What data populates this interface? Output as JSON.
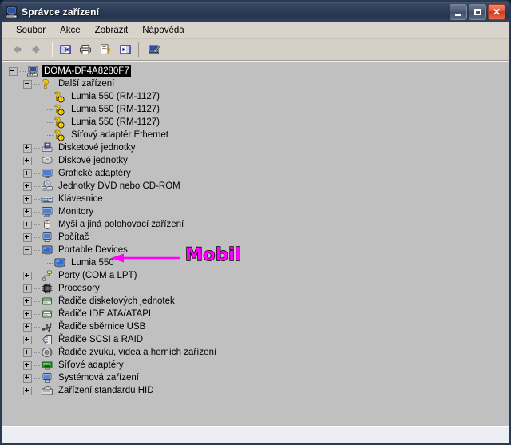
{
  "window": {
    "title": "Správce zařízení",
    "title_icon": "computer-icon",
    "buttons": {
      "minimize": "Minimalizovat",
      "maximize": "Maximalizovat",
      "close": "Zavřít"
    }
  },
  "menu": {
    "items": [
      {
        "label": "Soubor",
        "name": "menu-soubor"
      },
      {
        "label": "Akce",
        "name": "menu-akce"
      },
      {
        "label": "Zobrazit",
        "name": "menu-zobrazit"
      },
      {
        "label": "Nápověda",
        "name": "menu-napoveda"
      }
    ]
  },
  "toolbar": {
    "items": [
      {
        "name": "back-button",
        "icon": "arrow-left-icon",
        "title": "Zpět"
      },
      {
        "name": "forward-button",
        "icon": "arrow-right-icon",
        "title": "Vpřed"
      },
      {
        "name": "show-hide-tree-button",
        "icon": "tree-pane-icon",
        "title": "Zobrazit/skrýt strom konzoly"
      },
      {
        "name": "print-button",
        "icon": "printer-icon",
        "title": "Tisk"
      },
      {
        "name": "properties-button",
        "icon": "properties-help-icon",
        "title": "Vlastnosti"
      },
      {
        "name": "view-button",
        "icon": "view-pane-icon",
        "title": "Zobrazení"
      },
      {
        "name": "scan-hardware-button",
        "icon": "scan-hardware-icon",
        "title": "Vyhledat změny hardwaru"
      }
    ]
  },
  "tree": {
    "nodes": [
      {
        "label": "DOMA-DF4A8280F7",
        "level": 0,
        "state": "expanded",
        "icon": "computer-icon",
        "selected": true
      },
      {
        "label": "Další zařízení",
        "level": 1,
        "state": "expanded",
        "icon": "unknown-device-icon"
      },
      {
        "label": "Lumia 550 (RM-1127)",
        "level": 2,
        "state": "leaf",
        "icon": "unknown-device-warning-icon"
      },
      {
        "label": "Lumia 550 (RM-1127)",
        "level": 2,
        "state": "leaf",
        "icon": "unknown-device-warning-icon"
      },
      {
        "label": "Lumia 550 (RM-1127)",
        "level": 2,
        "state": "leaf",
        "icon": "unknown-device-warning-icon"
      },
      {
        "label": "Síťový adaptér Ethernet",
        "level": 2,
        "state": "leaf",
        "icon": "unknown-device-warning-icon"
      },
      {
        "label": "Disketové jednotky",
        "level": 1,
        "state": "collapsed",
        "icon": "floppy-drive-icon"
      },
      {
        "label": "Diskové jednotky",
        "level": 1,
        "state": "collapsed",
        "icon": "disk-drive-icon"
      },
      {
        "label": "Grafické adaptéry",
        "level": 1,
        "state": "collapsed",
        "icon": "display-adapter-icon"
      },
      {
        "label": "Jednotky DVD nebo CD-ROM",
        "level": 1,
        "state": "collapsed",
        "icon": "cdrom-icon"
      },
      {
        "label": "Klávesnice",
        "level": 1,
        "state": "collapsed",
        "icon": "keyboard-icon"
      },
      {
        "label": "Monitory",
        "level": 1,
        "state": "collapsed",
        "icon": "monitor-icon"
      },
      {
        "label": "Myši a jiná polohovací zařízení",
        "level": 1,
        "state": "collapsed",
        "icon": "mouse-icon"
      },
      {
        "label": "Počítač",
        "level": 1,
        "state": "collapsed",
        "icon": "computer-node-icon"
      },
      {
        "label": "Portable Devices",
        "level": 1,
        "state": "expanded",
        "icon": "portable-device-icon"
      },
      {
        "label": "Lumia 550",
        "level": 2,
        "state": "leaf",
        "icon": "portable-device-icon"
      },
      {
        "label": "Porty (COM a LPT)",
        "level": 1,
        "state": "collapsed",
        "icon": "port-icon"
      },
      {
        "label": "Procesory",
        "level": 1,
        "state": "collapsed",
        "icon": "processor-icon"
      },
      {
        "label": "Řadiče disketových jednotek",
        "level": 1,
        "state": "collapsed",
        "icon": "controller-icon"
      },
      {
        "label": "Řadiče IDE ATA/ATAPI",
        "level": 1,
        "state": "collapsed",
        "icon": "controller-icon"
      },
      {
        "label": "Řadiče sběrnice USB",
        "level": 1,
        "state": "collapsed",
        "icon": "usb-icon"
      },
      {
        "label": "Řadiče SCSI a RAID",
        "level": 1,
        "state": "collapsed",
        "icon": "scsi-icon"
      },
      {
        "label": "Řadiče zvuku, videa a herních zařízení",
        "level": 1,
        "state": "collapsed",
        "icon": "sound-icon"
      },
      {
        "label": "Síťové adaptéry",
        "level": 1,
        "state": "collapsed",
        "icon": "network-adapter-icon"
      },
      {
        "label": "Systémová zařízení",
        "level": 1,
        "state": "collapsed",
        "icon": "system-device-icon"
      },
      {
        "label": "Zařízení standardu HID",
        "level": 1,
        "state": "collapsed",
        "icon": "hid-device-icon"
      }
    ]
  },
  "annotation": {
    "text": "Mobil",
    "color": "#ff00ff",
    "outline_color": "#000000",
    "arrow_direction": "left",
    "points_at": "Lumia 550"
  },
  "statusbar": {
    "main": "",
    "pane2": "",
    "pane3": ""
  },
  "colors": {
    "title_gradient_start": "#4a5a74",
    "title_gradient_end": "#26354d",
    "window_face": "#d4d0c8",
    "tree_background": "#c0c0c0",
    "selection_background": "#000000",
    "selection_text": "#ffffff",
    "annotation": "#ff00ff",
    "close_button": "#e05033"
  }
}
